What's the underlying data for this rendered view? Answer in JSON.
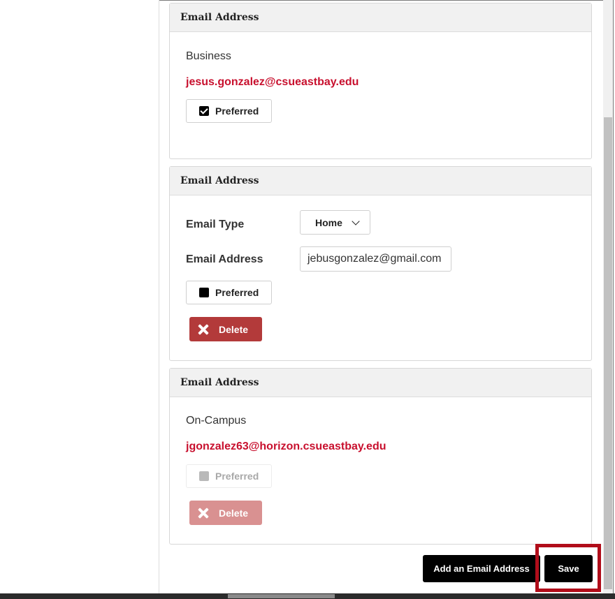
{
  "panels": [
    {
      "header": "Email Address",
      "type_label": "Business",
      "email": "jesus.gonzalez@csueastbay.edu",
      "preferred_label": "Preferred"
    },
    {
      "header": "Email Address",
      "email_type_label": "Email Type",
      "email_type_value": "Home",
      "email_address_label": "Email Address",
      "email_address_value": "jebusgonzalez@gmail.com",
      "preferred_label": "Preferred",
      "delete_label": "Delete"
    },
    {
      "header": "Email Address",
      "type_label": "On-Campus",
      "email": "jgonzalez63@horizon.csueastbay.edu",
      "preferred_label": "Preferred",
      "delete_label": "Delete"
    }
  ],
  "footer": {
    "add_label": "Add an Email Address",
    "save_label": "Save"
  },
  "colors": {
    "accent": "#c8102e",
    "delete": "#b33a3a",
    "highlight": "#b10d1a"
  },
  "icons": {
    "checkbox_checked": "check-square-icon",
    "checkbox_unchecked": "square-icon",
    "delete": "x-icon",
    "dropdown": "chevron-down-icon"
  }
}
